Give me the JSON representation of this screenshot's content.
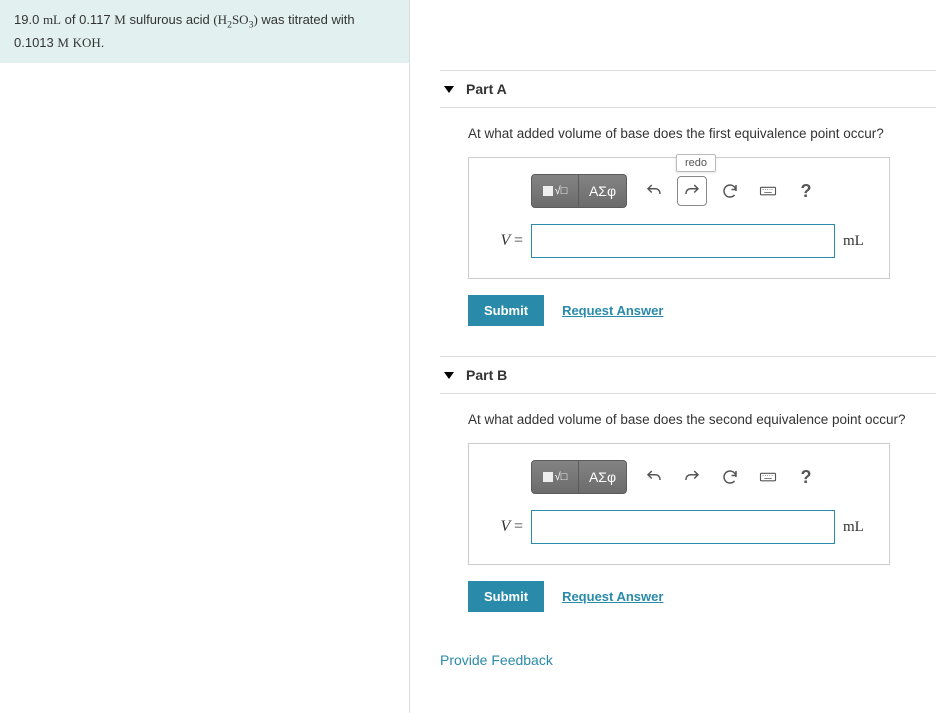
{
  "problem": {
    "volume_mL": "19.0",
    "unit1": "mL",
    "of": "of",
    "conc1": "0.117",
    "M1": "M",
    "acid_name": "sulfurous acid",
    "formula_prefix": "H",
    "formula_sub1": "2",
    "formula_mid": "SO",
    "formula_sub2": "3",
    "was_titrated": "was titrated with",
    "conc2": "0.1013",
    "M2": "M",
    "base": "KOH"
  },
  "parts": {
    "a": {
      "title": "Part A",
      "prompt": "At what added volume of base does the first equivalence point occur?",
      "var": "V",
      "equals": "=",
      "unit": "mL",
      "value": "",
      "submit": "Submit",
      "request": "Request Answer",
      "redo_tooltip": "redo"
    },
    "b": {
      "title": "Part B",
      "prompt": "At what added volume of base does the second equivalence point occur?",
      "var": "V",
      "equals": "=",
      "unit": "mL",
      "value": "",
      "submit": "Submit",
      "request": "Request Answer"
    }
  },
  "toolbar": {
    "greek": "ΑΣφ",
    "help": "?"
  },
  "feedback": "Provide Feedback"
}
